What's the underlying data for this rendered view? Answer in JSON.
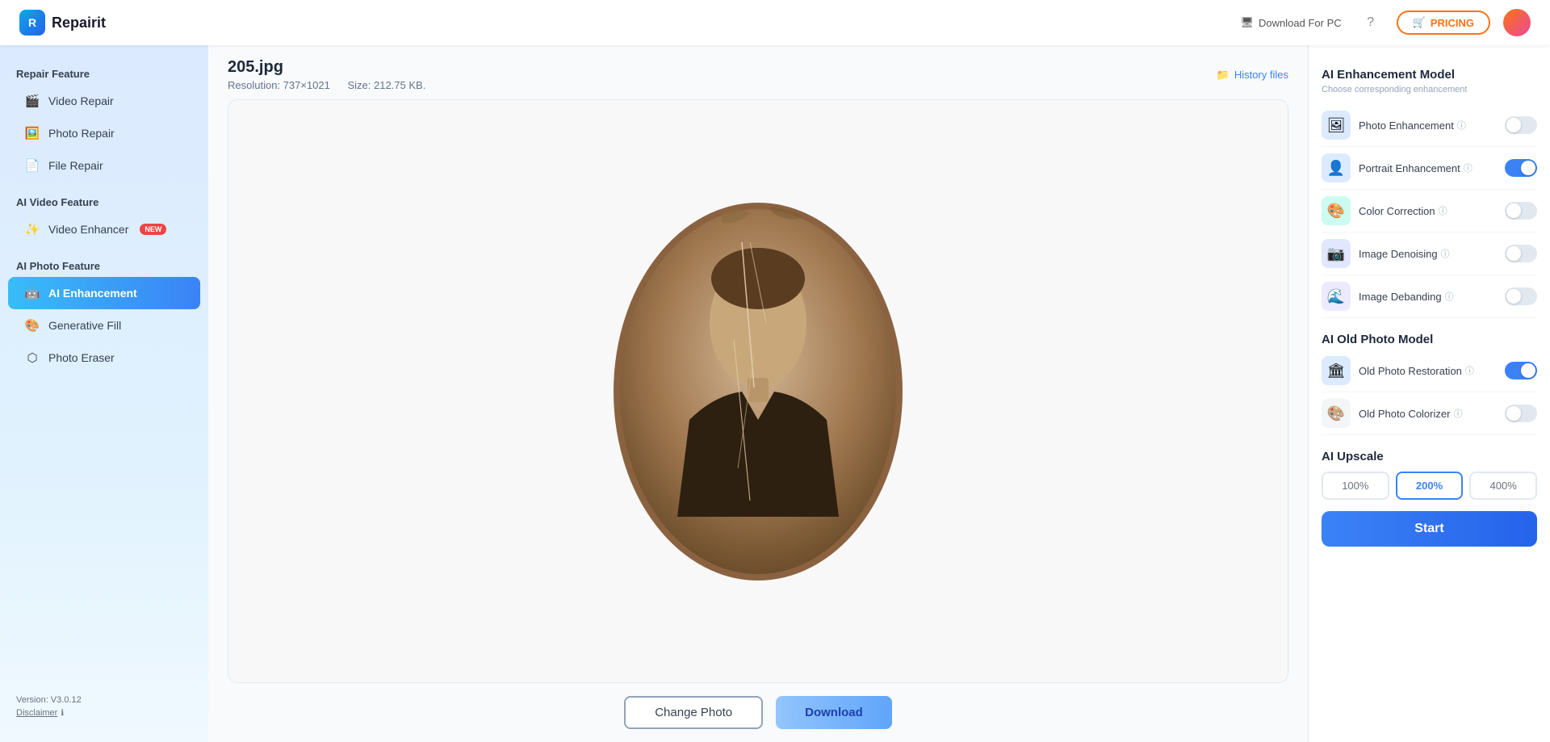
{
  "app": {
    "name": "Repairit",
    "logo_letter": "R"
  },
  "topnav": {
    "download_pc": "Download For PC",
    "pricing_label": "PRICING",
    "pricing_icon": "🛒"
  },
  "sidebar": {
    "repair_feature_label": "Repair Feature",
    "items_repair": [
      {
        "id": "video-repair",
        "label": "Video Repair",
        "icon": "🎬"
      },
      {
        "id": "photo-repair",
        "label": "Photo Repair",
        "icon": "🖼️"
      },
      {
        "id": "file-repair",
        "label": "File Repair",
        "icon": "📄"
      }
    ],
    "ai_video_label": "AI Video Feature",
    "items_ai_video": [
      {
        "id": "video-enhancer",
        "label": "Video Enhancer",
        "icon": "✨",
        "badge": "NEW"
      }
    ],
    "ai_photo_label": "AI Photo Feature",
    "items_ai_photo": [
      {
        "id": "ai-enhancement",
        "label": "AI Enhancement",
        "icon": "🤖",
        "active": true
      },
      {
        "id": "generative-fill",
        "label": "Generative Fill",
        "icon": "🎨"
      },
      {
        "id": "photo-eraser",
        "label": "Photo Eraser",
        "icon": "⬡"
      }
    ],
    "version": "Version: V3.0.12",
    "disclaimer": "Disclaimer"
  },
  "content": {
    "filename": "205.jpg",
    "resolution": "Resolution: 737×1021",
    "size": "Size: 212.75 KB.",
    "history_label": "History files"
  },
  "bottom_actions": {
    "change_photo": "Change Photo",
    "download": "Download"
  },
  "right_panel": {
    "enhancement_model_title": "AI Enhancement Model",
    "enhancement_model_sub": "Choose corresponding enhancement",
    "features": [
      {
        "id": "photo-enhancement",
        "label": "Photo Enhancement",
        "icon": "🖼",
        "icon_class": "blue",
        "on": false
      },
      {
        "id": "portrait-enhancement",
        "label": "Portrait Enhancement",
        "icon": "👤",
        "icon_class": "blue",
        "on": true
      },
      {
        "id": "color-correction",
        "label": "Color Correction",
        "icon": "🎨",
        "icon_class": "teal",
        "on": false
      },
      {
        "id": "image-denoising",
        "label": "Image Denoising",
        "icon": "📷",
        "icon_class": "indigo",
        "on": false
      },
      {
        "id": "image-debanding",
        "label": "Image Debanding",
        "icon": "🌊",
        "icon_class": "purple",
        "on": false
      }
    ],
    "old_photo_model_title": "AI Old Photo Model",
    "old_photo_features": [
      {
        "id": "old-photo-restoration",
        "label": "Old Photo Restoration",
        "icon": "🏛",
        "icon_class": "blue",
        "on": true
      },
      {
        "id": "old-photo-colorizer",
        "label": "Old Photo Colorizer",
        "icon": "🎨",
        "icon_class": "gray",
        "on": false
      }
    ],
    "upscale_title": "AI Upscale",
    "upscale_options": [
      {
        "label": "100%",
        "value": "100",
        "active": false
      },
      {
        "label": "200%",
        "value": "200",
        "active": true
      },
      {
        "label": "400%",
        "value": "400",
        "active": false
      }
    ],
    "start_label": "Start"
  }
}
